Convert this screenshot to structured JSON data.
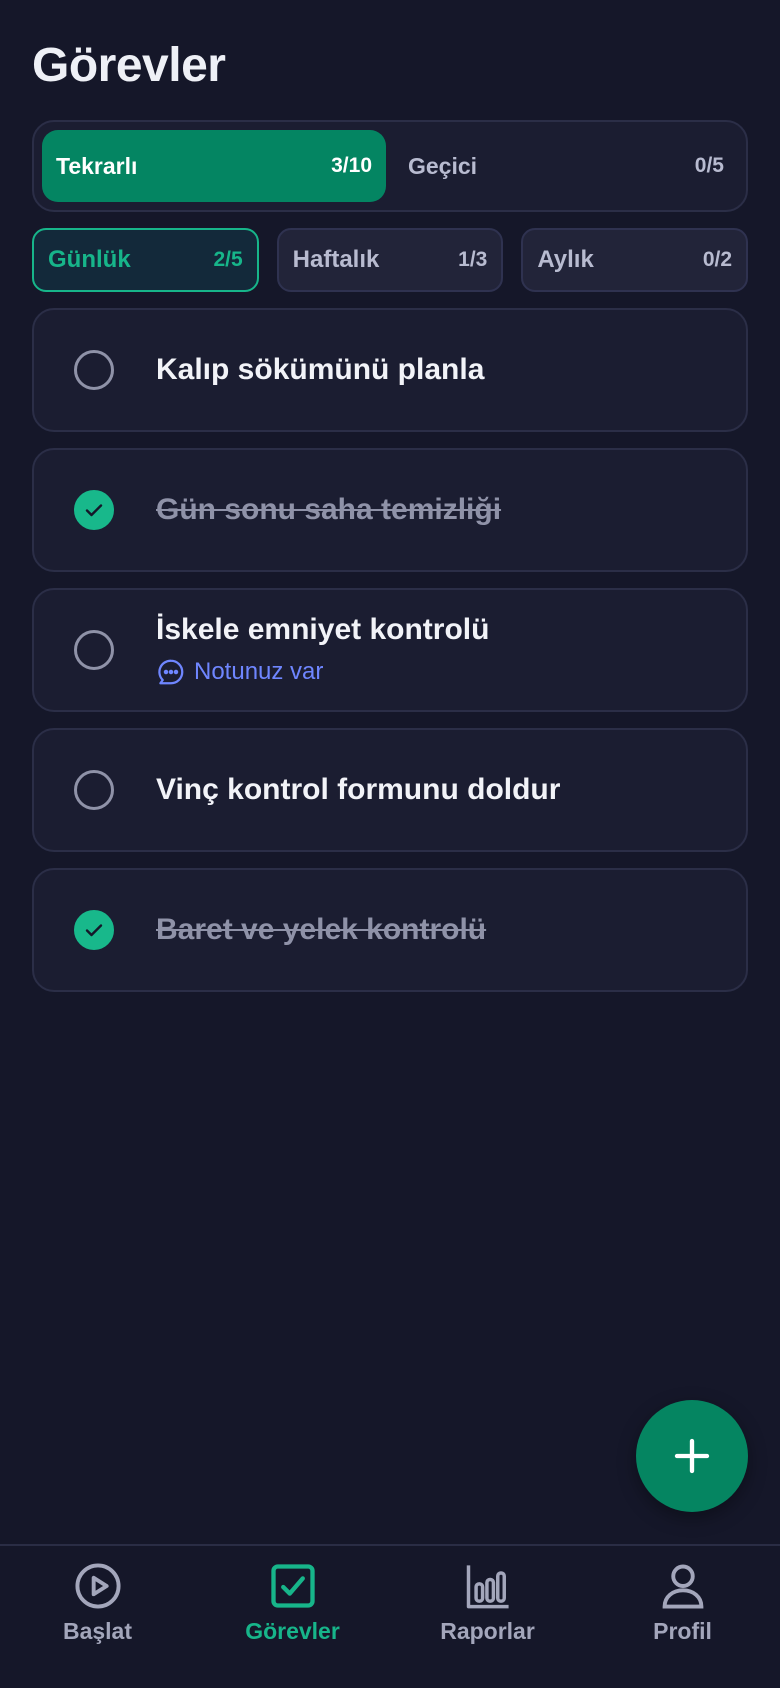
{
  "page": {
    "title": "Görevler"
  },
  "segment": {
    "tabs": [
      {
        "label": "Tekrarlı",
        "count": "3/10",
        "active": true
      },
      {
        "label": "Geçici",
        "count": "0/5",
        "active": false
      }
    ]
  },
  "frequency": {
    "chips": [
      {
        "label": "Günlük",
        "count": "2/5",
        "active": true
      },
      {
        "label": "Haftalık",
        "count": "1/3",
        "active": false
      },
      {
        "label": "Aylık",
        "count": "0/2",
        "active": false
      }
    ]
  },
  "tasks": [
    {
      "title": "Kalıp sökümünü planla",
      "done": false,
      "note": ""
    },
    {
      "title": "Gün sonu saha temizliği",
      "done": true,
      "note": ""
    },
    {
      "title": "İskele emniyet kontrolü",
      "done": false,
      "note": "Notunuz var"
    },
    {
      "title": "Vinç kontrol formunu doldur",
      "done": false,
      "note": ""
    },
    {
      "title": "Baret ve yelek kontrolü",
      "done": true,
      "note": ""
    }
  ],
  "fab": {
    "icon": "plus-icon"
  },
  "nav": {
    "items": [
      {
        "label": "Başlat",
        "icon": "play-icon",
        "active": false
      },
      {
        "label": "Görevler",
        "icon": "checkbox-icon",
        "active": true
      },
      {
        "label": "Raporlar",
        "icon": "bar-chart-icon",
        "active": false
      },
      {
        "label": "Profil",
        "icon": "user-icon",
        "active": false
      }
    ]
  },
  "colors": {
    "background": "#151729",
    "accent": "#048562",
    "accent_text": "#17b58a",
    "note": "#6f86ff"
  }
}
